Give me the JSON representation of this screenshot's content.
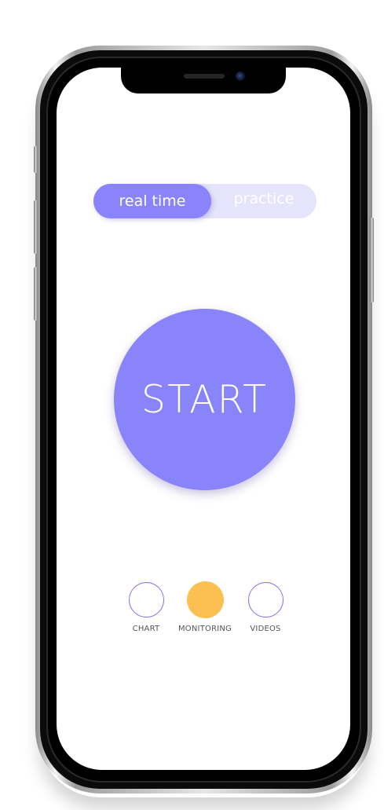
{
  "mode_toggle": {
    "active_label": "real time",
    "inactive_label": "practice"
  },
  "start_button": {
    "label": "START"
  },
  "bottom_nav": {
    "items": [
      {
        "label": "CHART",
        "icon": "empty-circle-icon",
        "selected": false
      },
      {
        "label": "MONITORING",
        "icon": "filled-circle-icon",
        "selected": true
      },
      {
        "label": "VIDEOS",
        "icon": "empty-circle-icon",
        "selected": false
      }
    ]
  },
  "colors": {
    "accent": "#8a84fb",
    "toggle_track": "#e6e3fc",
    "selected_nav": "#fbbf52",
    "outline": "#7c76f0"
  }
}
